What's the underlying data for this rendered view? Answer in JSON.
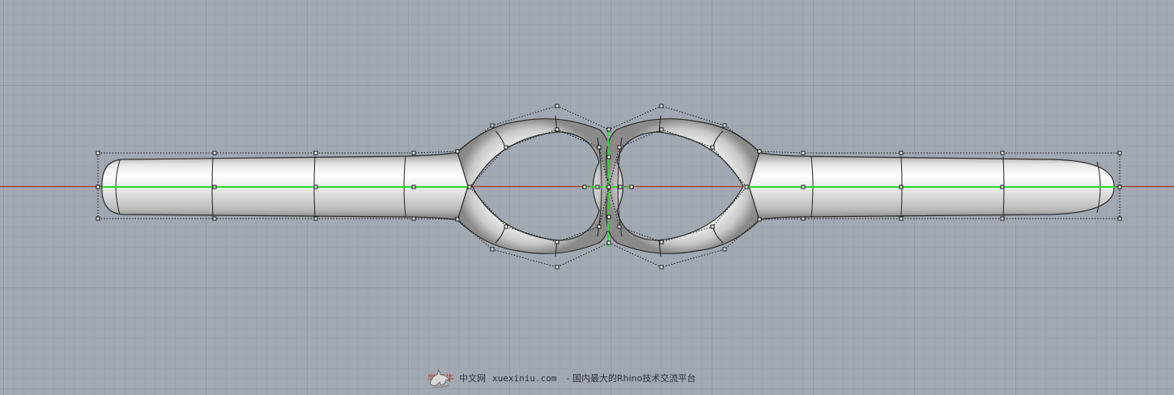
{
  "viewport": {
    "name": "top-viewport",
    "background_color": "#a3a9b2",
    "grid_minor_color": "#98a0aa",
    "grid_major_color": "#7f8791",
    "x_axis_color": "#a63a2a",
    "centerline_color": "#22dd22",
    "object": "bracelet-ring-surface"
  },
  "watermark": {
    "brand": "学犀牛",
    "site": "中文网",
    "url": "xuexiniu.com",
    "tagline": "- 国内最大的Rhino技术交流平台"
  }
}
